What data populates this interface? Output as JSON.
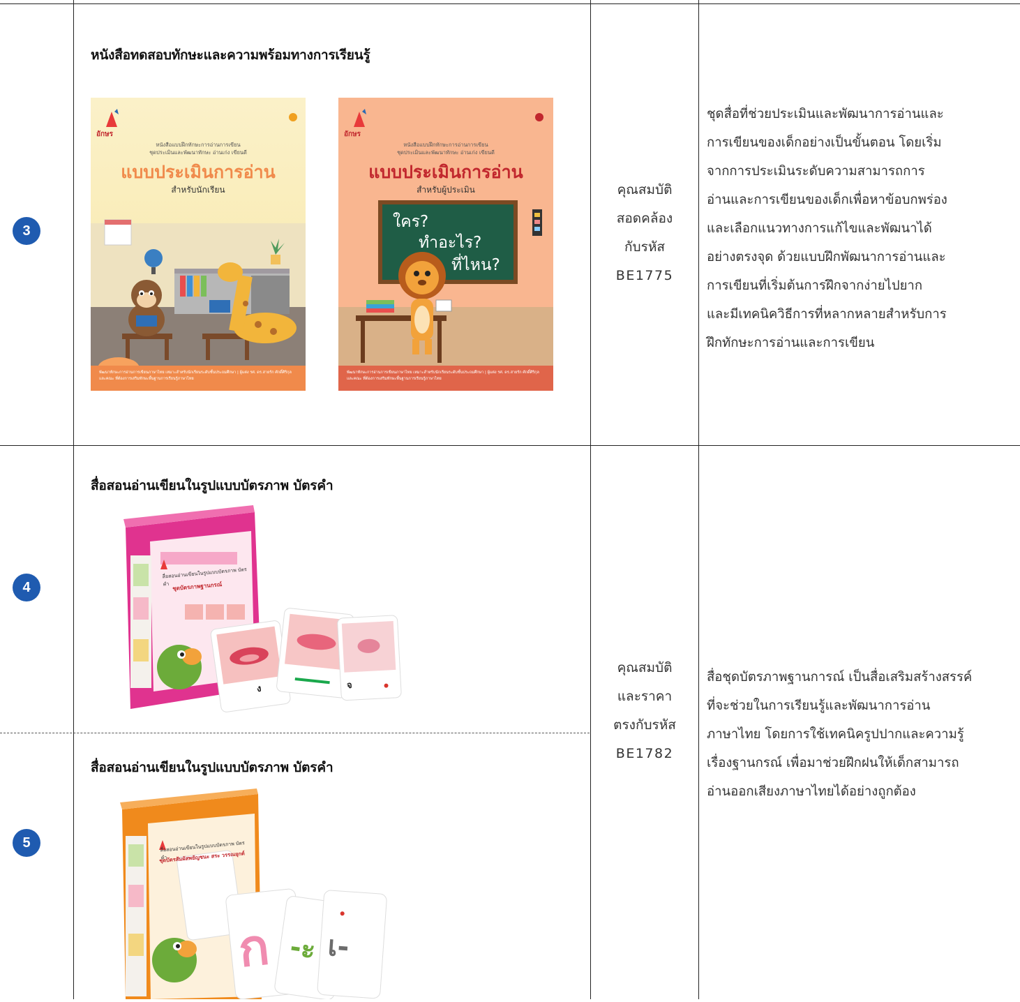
{
  "items": [
    {
      "number": "3",
      "title": "หนังสือทดสอบทักษะและความพร้อมทางการเรียนรู้",
      "books": [
        {
          "brand": "อักษร",
          "top_line1": "หนังสือแบบฝึกทักษะการอ่านการเขียน",
          "top_line2": "ชุดประเมินและพัฒนาทักษะ อ่านเก่ง เขียนดี",
          "title": "แบบประเมินการอ่าน",
          "subtitle": "สำหรับนักเรียน",
          "footer": "พัฒนาทักษะการอ่านการเขียนภาษาไทย เหมาะสำหรับนักเรียนระดับชั้นประถมศึกษา | ผู้แต่ง รศ. ดร.สายรัก ศักดิ์ศิริกุล และคณะ ที่ต้องการเสริมทักษะพื้นฐานการเรียนรู้ภาษาไทย",
          "accent": "#f08a4b"
        },
        {
          "brand": "อักษร",
          "top_line1": "หนังสือแบบฝึกทักษะการอ่านการเขียน",
          "top_line2": "ชุดประเมินและพัฒนาทักษะ อ่านเก่ง เขียนดี",
          "title": "แบบประเมินการอ่าน",
          "subtitle": "สำหรับผู้ประเมิน",
          "board_line1": "ใคร?",
          "board_line2": "ทำอะไร?",
          "board_line3": "ที่ไหน?",
          "footer": "พัฒนาทักษะการอ่านการเขียนภาษาไทย เหมาะสำหรับนักเรียนระดับชั้นประถมศึกษา | ผู้แต่ง รศ. ดร.สายรัก ศักดิ์ศิริกุล และคณะ ที่ต้องการเสริมทักษะพื้นฐานการเรียนรู้ภาษาไทย",
          "accent": "#c1272d"
        }
      ]
    },
    {
      "number": "4",
      "title": "สื่อสอนอ่านเขียนในรูปแบบบัตรภาพ บัตรคำ",
      "box_color": "#e0338f",
      "box_title": "สื่อสอนอ่านเขียนในรูปแบบบัตรภาพ บัตรคำ",
      "box_subtitle": "ชุดบัตรภาพฐานกรณ์",
      "card_letters": [
        "ง",
        "—",
        "จ"
      ]
    },
    {
      "number": "5",
      "title": "สื่อสอนอ่านเขียนในรูปแบบบัตรภาพ บัตรคำ",
      "box_color": "#f08a1c",
      "box_title": "สื่อสอนอ่านเขียนในรูปแบบบัตรภาพ บัตรคำ",
      "box_subtitle": "ชุดบัตรสัมผัสพยัญชนะ สระ วรรณยุกต์",
      "card_letters": [
        "ก",
        "-ะ",
        "เ-"
      ]
    }
  ],
  "properties": [
    {
      "line1": "คุณสมบัติ",
      "line2": "สอดคล้อง",
      "line3": "กับรหัส",
      "code": "BE1775"
    },
    {
      "line1": "คุณสมบัติ",
      "line2": "และราคา",
      "line3": "ตรงกับรหัส",
      "code": "BE1782"
    }
  ],
  "descriptions": [
    {
      "lines": [
        "ชุดสื่อที่ช่วยประเมินและพัฒนาการอ่านและ",
        "การเขียนของเด็กอย่างเป็นขั้นตอน โดยเริ่ม",
        "จากการประเมินระดับความสามารถการ",
        "อ่านและการเขียนของเด็กเพื่อหาข้อบกพร่อง",
        "และเลือกแนวทางการแก้ไขและพัฒนาได้",
        "อย่างตรงจุด ด้วยแบบฝึกพัฒนาการอ่านและ",
        "การเขียนที่เริ่มต้นการฝึกจากง่ายไปยาก",
        "และมีเทคนิควิธีการที่หลากหลายสำหรับการ",
        "ฝึกทักษะการอ่านและการเขียน"
      ]
    },
    {
      "lines": [
        "สื่อชุดบัตรภาพฐานการณ์ เป็นสื่อเสริมสร้างสรรค์",
        "ที่จะช่วยในการเรียนรู้และพัฒนาการอ่าน",
        "ภาษาไทย โดยการใช้เทคนิครูปปากและความรู้",
        "เรื่องฐานกรณ์ เพื่อมาช่วยฝึกฝนให้เด็กสามารถ",
        "อ่านออกเสียงภาษาไทยได้อย่างถูกต้อง"
      ]
    }
  ]
}
